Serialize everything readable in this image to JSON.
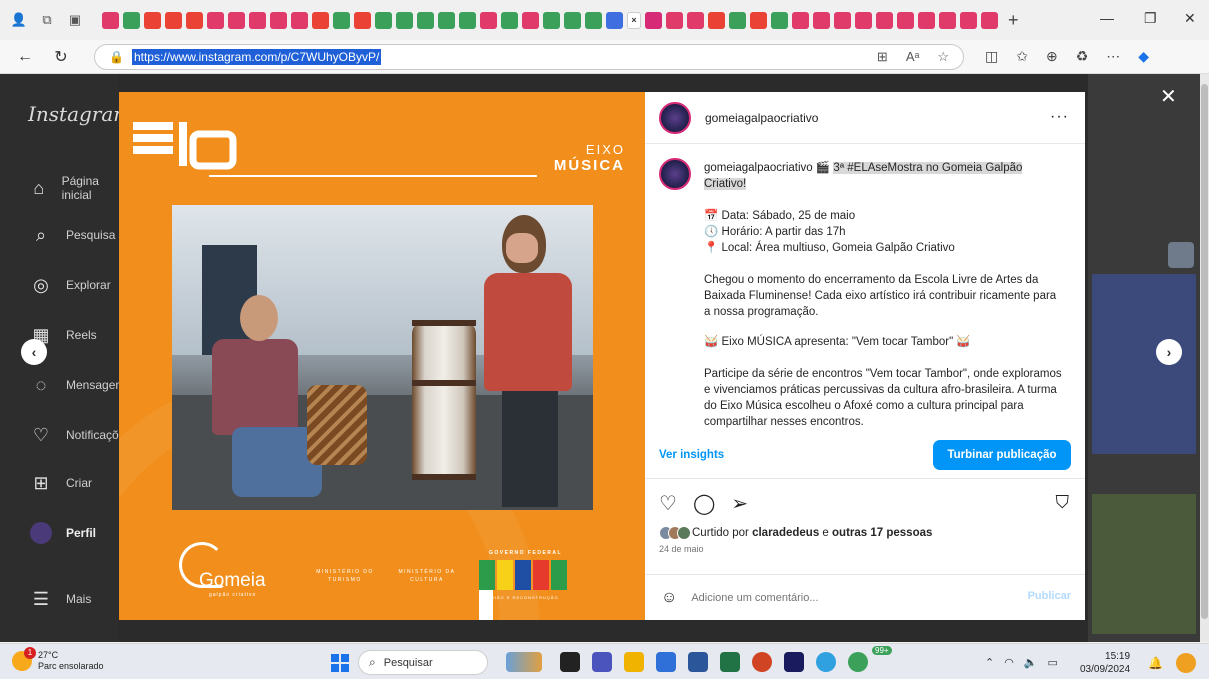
{
  "browser": {
    "url": "https://www.instagram.com/p/C7WUhyOByvP/"
  },
  "instagram": {
    "logo": "Instagram",
    "nav": [
      {
        "label": "Página inicial",
        "icon": "home-icon"
      },
      {
        "label": "Pesquisa",
        "icon": "search-icon"
      },
      {
        "label": "Explorar",
        "icon": "compass-icon"
      },
      {
        "label": "Reels",
        "icon": "reels-icon"
      },
      {
        "label": "Mensagens",
        "icon": "messenger-icon"
      },
      {
        "label": "Notificações",
        "icon": "heart-icon"
      },
      {
        "label": "Criar",
        "icon": "plus-icon"
      },
      {
        "label": "Perfil",
        "icon": "avatar"
      },
      {
        "label": "Mais",
        "icon": "menu-icon"
      }
    ]
  },
  "post_image": {
    "eixo": "EIXO",
    "musica": "MÚSICA",
    "gomeia": "Gomeia",
    "gomeia_sub": "galpão criativo",
    "min_turismo": "MINISTÉRIO DO TURISMO",
    "min_cultura": "MINISTÉRIO DA CULTURA",
    "gov_federal": "GOVERNO FEDERAL",
    "brasil": "BRASIL",
    "uniao": "UNIÃO E RECONSTRUÇÃO"
  },
  "post": {
    "username": "gomeiagalpaocriativo",
    "caption_title": "3ª #ELAseMostra no Gomeia Galpão Criativo!",
    "data": "Data: Sábado, 25 de maio",
    "horario": "Horário: A partir das 17h",
    "local": "Local: Área multiuso, Gomeia Galpão Criativo",
    "para1": "Chegou o momento do encerramento da Escola Livre de Artes da Baixada Fluminense! Cada eixo artístico irá contribuir ricamente para a nossa programação.",
    "para2": "Eixo MÚSICA apresenta: \"Vem tocar Tambor\"",
    "para3": "Participe da série de encontros \"Vem tocar Tambor\", onde exploramos e vivenciamos práticas percussivas da cultura afro-brasileira. A turma do Eixo Música escolheu o Afoxé como a cultura principal para compartilhar nesses encontros.",
    "ver_insights": "Ver insights",
    "boost": "Turbinar publicação",
    "liked_prefix": "Curtido por",
    "liked_user": "claradedeus",
    "liked_and": "e",
    "liked_others": "outras 17 pessoas",
    "date": "24 de maio",
    "comment_placeholder": "Adicione um comentário...",
    "publish": "Publicar"
  },
  "taskbar": {
    "temp": "27°C",
    "weather": "Parc ensolarado",
    "search": "Pesquisar",
    "time": "15:19",
    "date": "03/09/2024",
    "badge": "99+"
  }
}
